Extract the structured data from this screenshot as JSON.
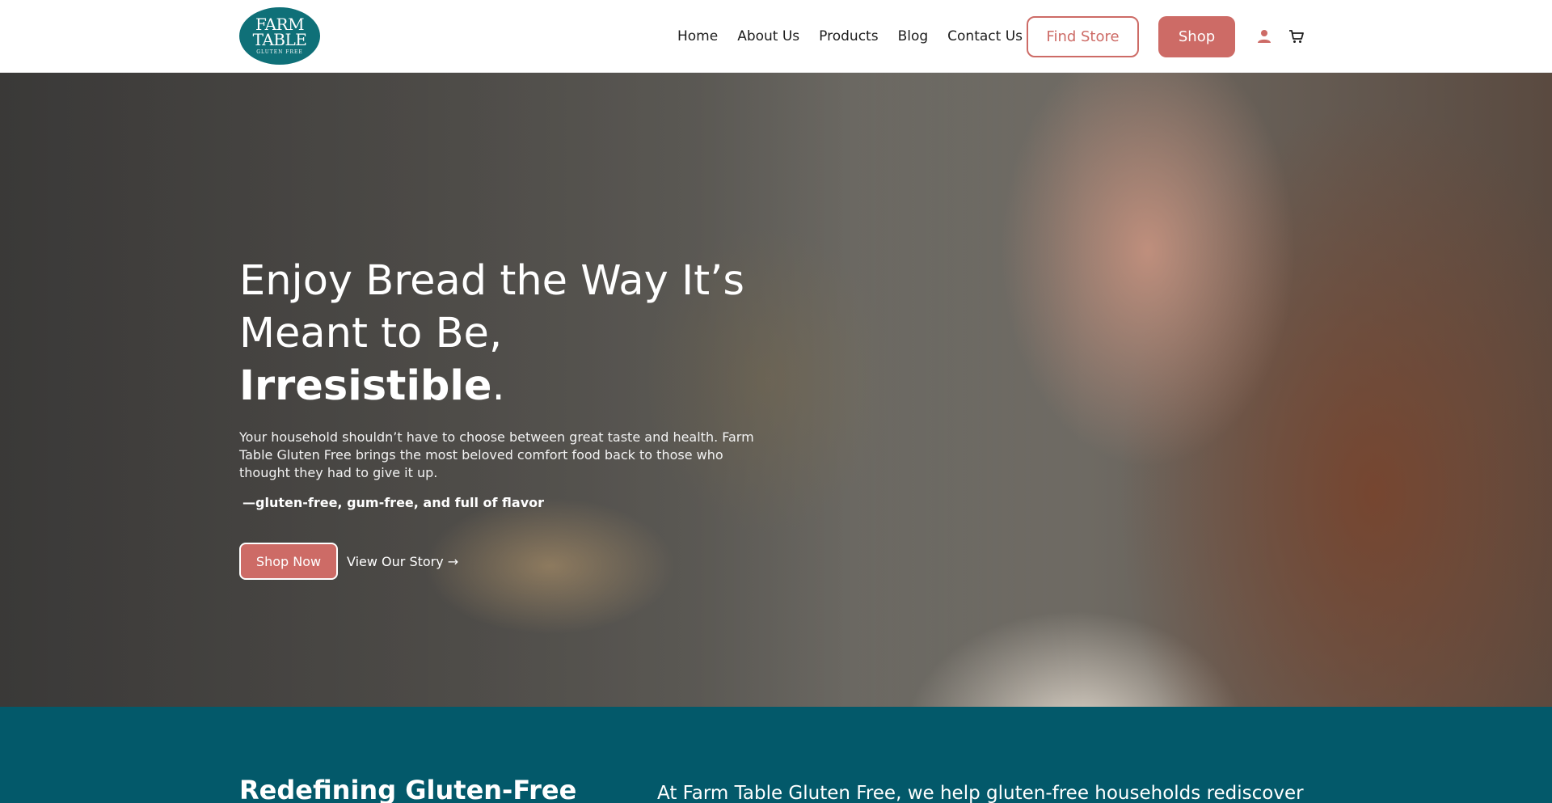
{
  "brand": {
    "logo_line1": "FARM",
    "logo_line2": "TABLE",
    "logo_line3": "GLUTEN FREE"
  },
  "nav": {
    "links": [
      {
        "label": "Home"
      },
      {
        "label": "About Us"
      },
      {
        "label": "Products"
      },
      {
        "label": "Blog"
      },
      {
        "label": "Contact Us"
      }
    ],
    "find_store_label": "Find Store",
    "shop_label": "Shop",
    "user_icon": "user-icon",
    "cart_icon": "cart-icon"
  },
  "hero": {
    "title_part1": "Enjoy Bread the Way It’s",
    "title_part2": "Meant to Be, ",
    "title_emphasis": "Irresistible",
    "title_end": ".",
    "subtitle": "Your household shouldn’t have to choose between great taste and health. Farm Table Gluten Free brings the most beloved comfort food back to those who thought they had to give it up.",
    "tagline": "—gluten-free, gum-free, and full of flavor",
    "primary_cta": "Shop Now",
    "secondary_cta": "View Our Story →"
  },
  "band": {
    "heading": "Redefining Gluten-Free",
    "text": "At Farm Table Gluten Free, we help gluten-free households rediscover"
  },
  "colors": {
    "brand_teal": "#0f7078",
    "accent_coral": "#cd6b66",
    "band_teal": "#03596a"
  }
}
